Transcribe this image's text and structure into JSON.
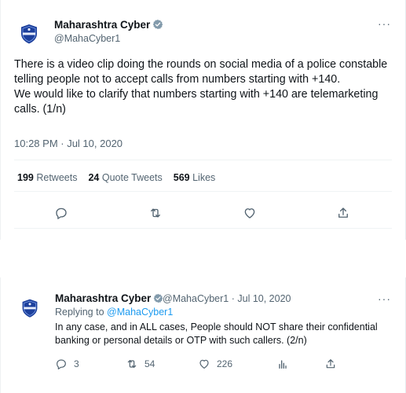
{
  "tweet1": {
    "author_name": "Maharashtra Cyber",
    "author_handle": "@MahaCyber1",
    "text_lines": [
      "There is a video clip doing the rounds on social media of a police constable telling people not to accept calls from numbers starting with +140.",
      "We would like to clarify that numbers starting with +140 are telemarketing calls.  (1/n)"
    ],
    "timestamp": "10:28 PM · Jul 10, 2020",
    "stats": {
      "retweets_count": "199",
      "retweets_label": "Retweets",
      "quote_count": "24",
      "quote_label": "Quote Tweets",
      "likes_count": "569",
      "likes_label": "Likes"
    },
    "icons": [
      "reply-icon",
      "retweet-icon",
      "like-icon",
      "share-icon"
    ]
  },
  "tweet2": {
    "author_name": "Maharashtra Cyber",
    "handle_and_date": "@MahaCyber1 · Jul 10, 2020",
    "replying_prefix": "Replying to",
    "replying_handle": "@MahaCyber1",
    "text": "In any case, and in ALL cases, People should NOT share their confidential banking or personal details or OTP with such callers.  (2/n)",
    "counts": {
      "replies": "3",
      "retweets": "54",
      "likes": "226"
    },
    "icons": [
      "reply-icon",
      "retweet-icon",
      "like-icon",
      "analytics-icon",
      "share-icon"
    ]
  },
  "colors": {
    "text_primary": "#0f1419",
    "text_secondary": "#536471",
    "link": "#1d9bf0",
    "verified_badge": "#829aab",
    "avatar_shield": "#1c3f9c"
  }
}
